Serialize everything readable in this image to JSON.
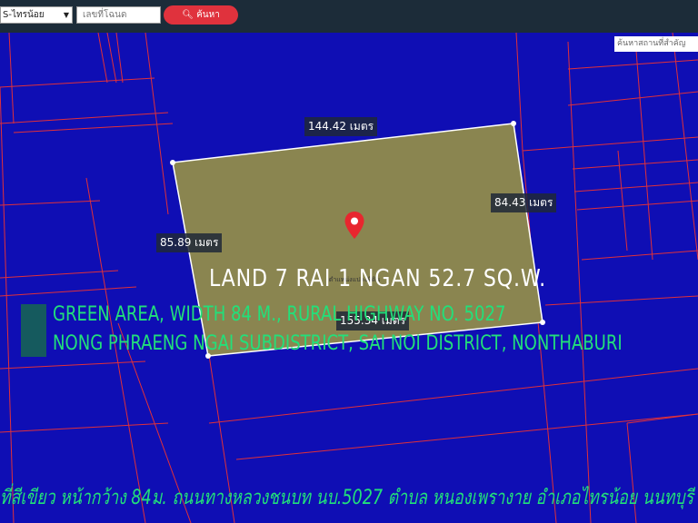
{
  "toolbar": {
    "district_select": "S-ไทรน้อย",
    "deed_input_placeholder": "เลขที่โฉนด",
    "search_button": "ค้นหา"
  },
  "map": {
    "place_search": "ค้นหาสถานที่สำคัญ",
    "plot_label": "ตำแหน่งแปลงที่ดิน",
    "dimensions": {
      "top": "144.42 เมตร",
      "right": "84.43 เมตร",
      "left": "85.89 เมตร",
      "bottom": "155.34 เมตร"
    },
    "colors": {
      "background": "#0f0eb4",
      "plot_fill": "#8a8550",
      "parcel_lines": "#e0303a"
    }
  },
  "overlay": {
    "headline": "LAND 7 RAI 1 NGAN 52.7 SQ.W.",
    "line1": "GREEN AREA, WIDTH 84 M., RURAL HIGHWAY NO. 5027",
    "line2": "NONG PHRAENG NGAI SUBDISTRICT, SAI NOI DISTRICT, NONTHABURI",
    "thai_caption": "ที่สีเขียว หน้ากว้าง 84ม. ถนนทางหลวงชนบท นบ.5027 ตำบล หนองเพรางาย อำเภอไทรน้อย นนทบุรี"
  }
}
